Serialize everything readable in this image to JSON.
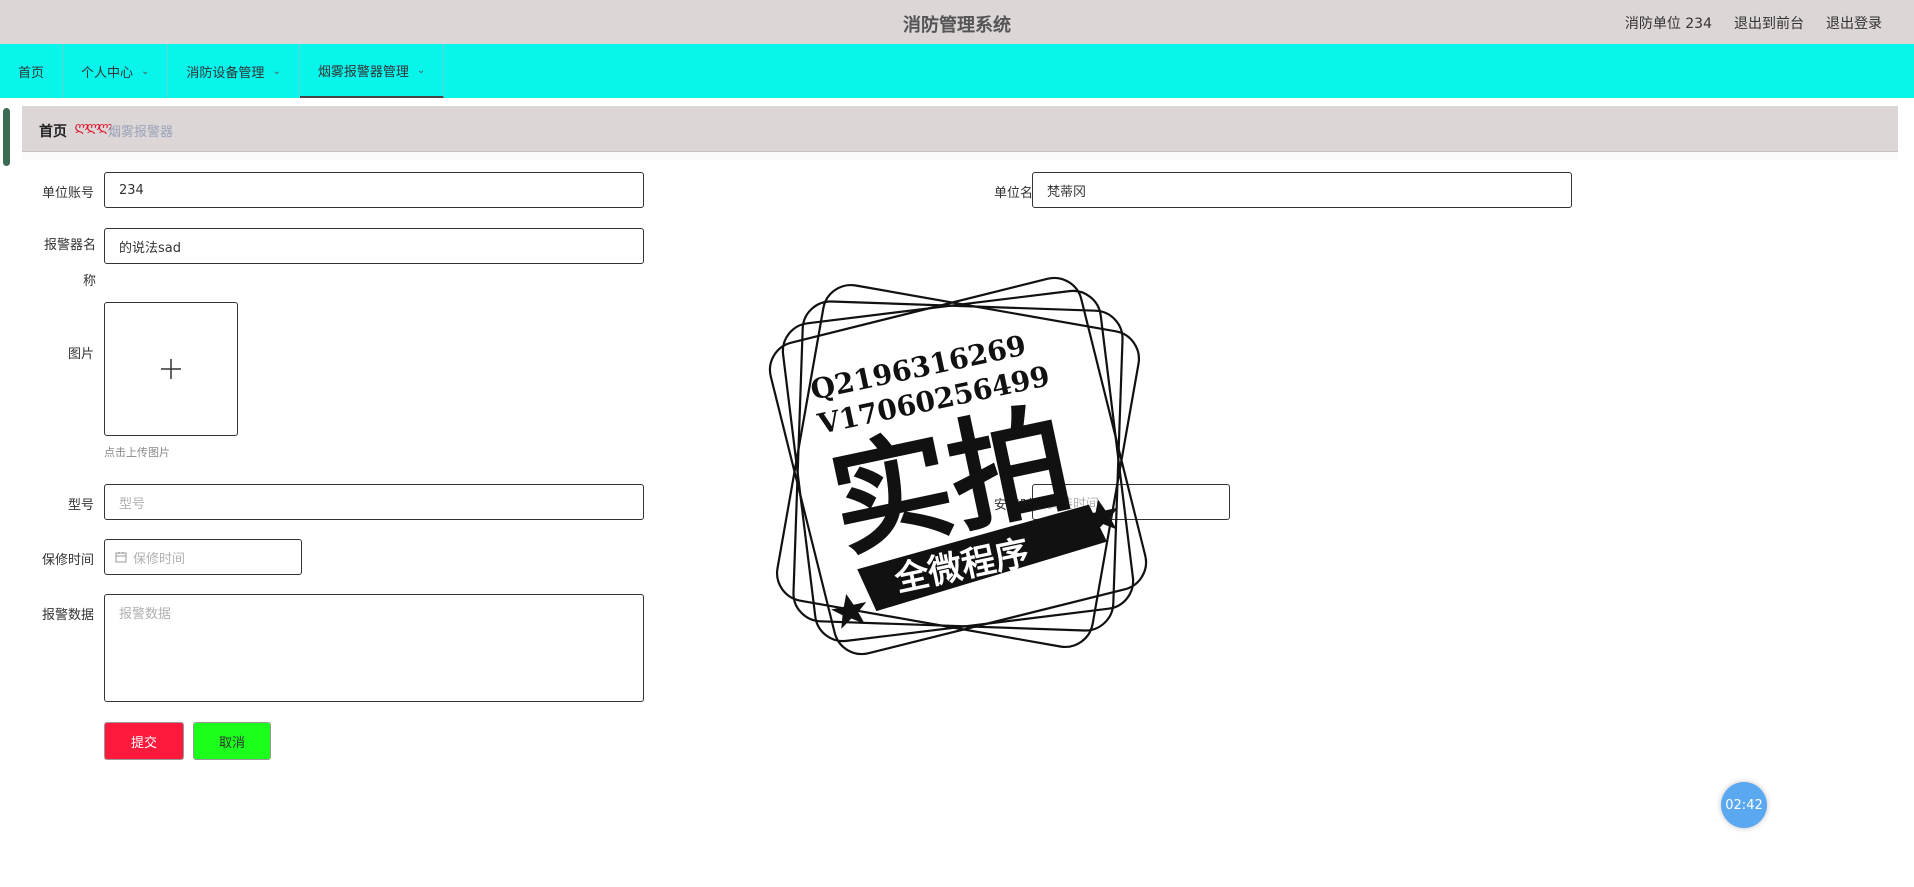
{
  "header": {
    "app_title": "消防管理系统",
    "user_label": "消防单位 234",
    "back_to_front": "退出到前台",
    "logout": "退出登录"
  },
  "nav": {
    "items": [
      {
        "label": "首页",
        "has_dropdown": false
      },
      {
        "label": "个人中心",
        "has_dropdown": true
      },
      {
        "label": "消防设备管理",
        "has_dropdown": true
      },
      {
        "label": "烟雾报警器管理",
        "has_dropdown": true,
        "active": true
      }
    ]
  },
  "breadcrumb": {
    "home": "首页",
    "separator": "ლლლ",
    "current": "烟雾报警器"
  },
  "form": {
    "unit_account_label": "单位账号",
    "unit_account_value": "234",
    "unit_name_label": "单位名称",
    "unit_name_value": "梵蒂冈",
    "alarm_name_label": "报警器名称",
    "alarm_name_value": "的说法sad",
    "image_label": "图片",
    "upload_hint": "点击上传图片",
    "model_label": "型号",
    "model_placeholder": "型号",
    "install_label": "安装时间",
    "install_placeholder": "安装时间",
    "warranty_label": "保修时间",
    "warranty_placeholder": "保修时间",
    "alarm_data_label": "报警数据",
    "alarm_data_placeholder": "报警数据",
    "submit": "提交",
    "cancel": "取消"
  },
  "timer": "02:42",
  "watermark": {
    "line1": "Q2196316269",
    "line2": "V17060256499",
    "big": "实拍",
    "banner": "全微程序"
  },
  "colors": {
    "header_bg": "#dcd6d6",
    "nav_bg": "#08f5ec",
    "submit_bg": "#ff1a3d",
    "cancel_bg": "#1cff1c",
    "timer_bg": "#5aa8f0"
  }
}
